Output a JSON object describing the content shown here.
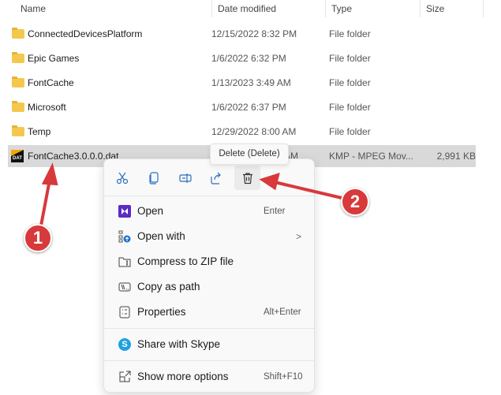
{
  "columns": {
    "name": "Name",
    "date": "Date modified",
    "type": "Type",
    "size": "Size"
  },
  "files": [
    {
      "name": "ConnectedDevicesPlatform",
      "date": "12/15/2022 8:32 PM",
      "type": "File folder",
      "size": ""
    },
    {
      "name": "Epic Games",
      "date": "1/6/2022 6:32 PM",
      "type": "File folder",
      "size": ""
    },
    {
      "name": "FontCache",
      "date": "1/13/2023 3:49 AM",
      "type": "File folder",
      "size": ""
    },
    {
      "name": "Microsoft",
      "date": "1/6/2022 6:37 PM",
      "type": "File folder",
      "size": ""
    },
    {
      "name": "Temp",
      "date": "12/29/2022 8:00 AM",
      "type": "File folder",
      "size": ""
    },
    {
      "name": "FontCache3.0.0.0.dat",
      "date": "AM",
      "type": "KMP - MPEG Mov...",
      "size": "2,991 KB",
      "selected": true,
      "icon_label": "DAT"
    }
  ],
  "tooltip": "Delete (Delete)",
  "toolbar": [
    "cut-icon",
    "copy-icon",
    "rename-icon",
    "share-icon",
    "delete-icon"
  ],
  "menu": {
    "open": {
      "label": "Open",
      "shortcut": "Enter"
    },
    "open_with": {
      "label": "Open with"
    },
    "compress": {
      "label": "Compress to ZIP file"
    },
    "copy_path": {
      "label": "Copy as path"
    },
    "properties": {
      "label": "Properties",
      "shortcut": "Alt+Enter"
    },
    "skype": {
      "label": "Share with Skype"
    },
    "more": {
      "label": "Show more options",
      "shortcut": "Shift+F10"
    }
  },
  "annotations": {
    "step1": "1",
    "step2": "2",
    "color": "#d8393b"
  }
}
